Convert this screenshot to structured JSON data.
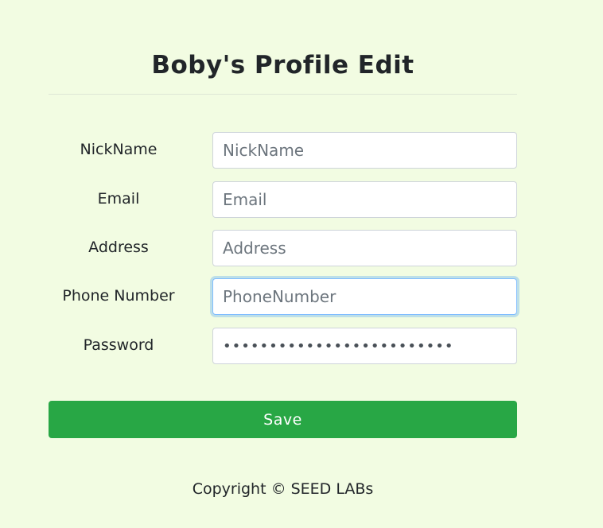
{
  "page": {
    "title": "Boby's Profile Edit"
  },
  "form": {
    "fields": [
      {
        "label": "NickName",
        "placeholder": "NickName",
        "value": ""
      },
      {
        "label": "Email",
        "placeholder": "Email",
        "value": ""
      },
      {
        "label": "Address",
        "placeholder": "Address",
        "value": ""
      },
      {
        "label": "Phone Number",
        "placeholder": "PhoneNumber",
        "value": ""
      },
      {
        "label": "Password",
        "placeholder": "",
        "value": "•••••••••••••••••••••••••"
      }
    ],
    "save_label": "Save"
  },
  "footer": {
    "text": "Copyright © SEED LABs"
  },
  "colors": {
    "background": "#f2fce2",
    "save_button": "#28a745",
    "focus_border": "#80bdff"
  }
}
